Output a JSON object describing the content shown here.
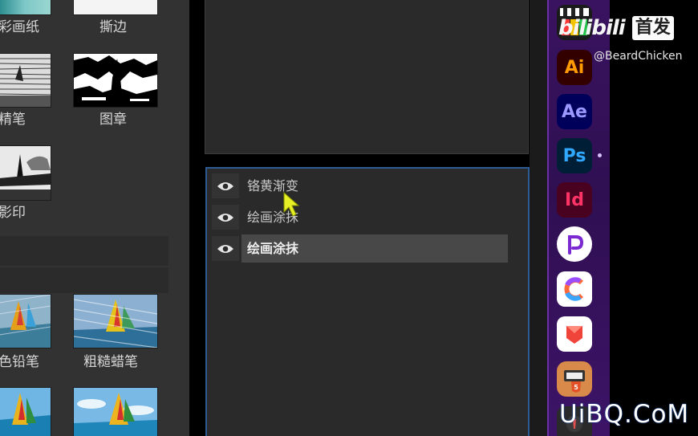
{
  "gallery": {
    "captions": {
      "r1_left": "彩画纸",
      "r1_right": "撕边",
      "r2_left": "精笔",
      "r2_right": "图章",
      "r3_left": "影印",
      "r4_left": "色铅笔",
      "r4_right": "粗糙蜡笔"
    }
  },
  "layers": {
    "items": [
      {
        "name": "铬黄渐变",
        "selected": false
      },
      {
        "name": "绘画涂抹",
        "selected": false
      },
      {
        "name": "绘画涂抹",
        "selected": true
      }
    ]
  },
  "dock": {
    "apps": [
      {
        "name": "final-cut-pro"
      },
      {
        "label": "Ai",
        "name": "illustrator",
        "bg": "#330000",
        "fg": "#ff9a00"
      },
      {
        "label": "Ae",
        "name": "after-effects",
        "bg": "#00005b",
        "fg": "#9999ff"
      },
      {
        "label": "Ps",
        "name": "photoshop",
        "bg": "#001e36",
        "fg": "#31a8ff"
      },
      {
        "label": "Id",
        "name": "indesign",
        "bg": "#49021f",
        "fg": "#ff3366"
      },
      {
        "name": "p-app"
      },
      {
        "name": "c-app"
      },
      {
        "name": "red-app"
      },
      {
        "name": "html5-app"
      }
    ]
  },
  "watermark": {
    "logo_text": "bilibili",
    "badge": "首发",
    "handle": "@BeardChicken",
    "site": "UiBQ.CoM"
  }
}
